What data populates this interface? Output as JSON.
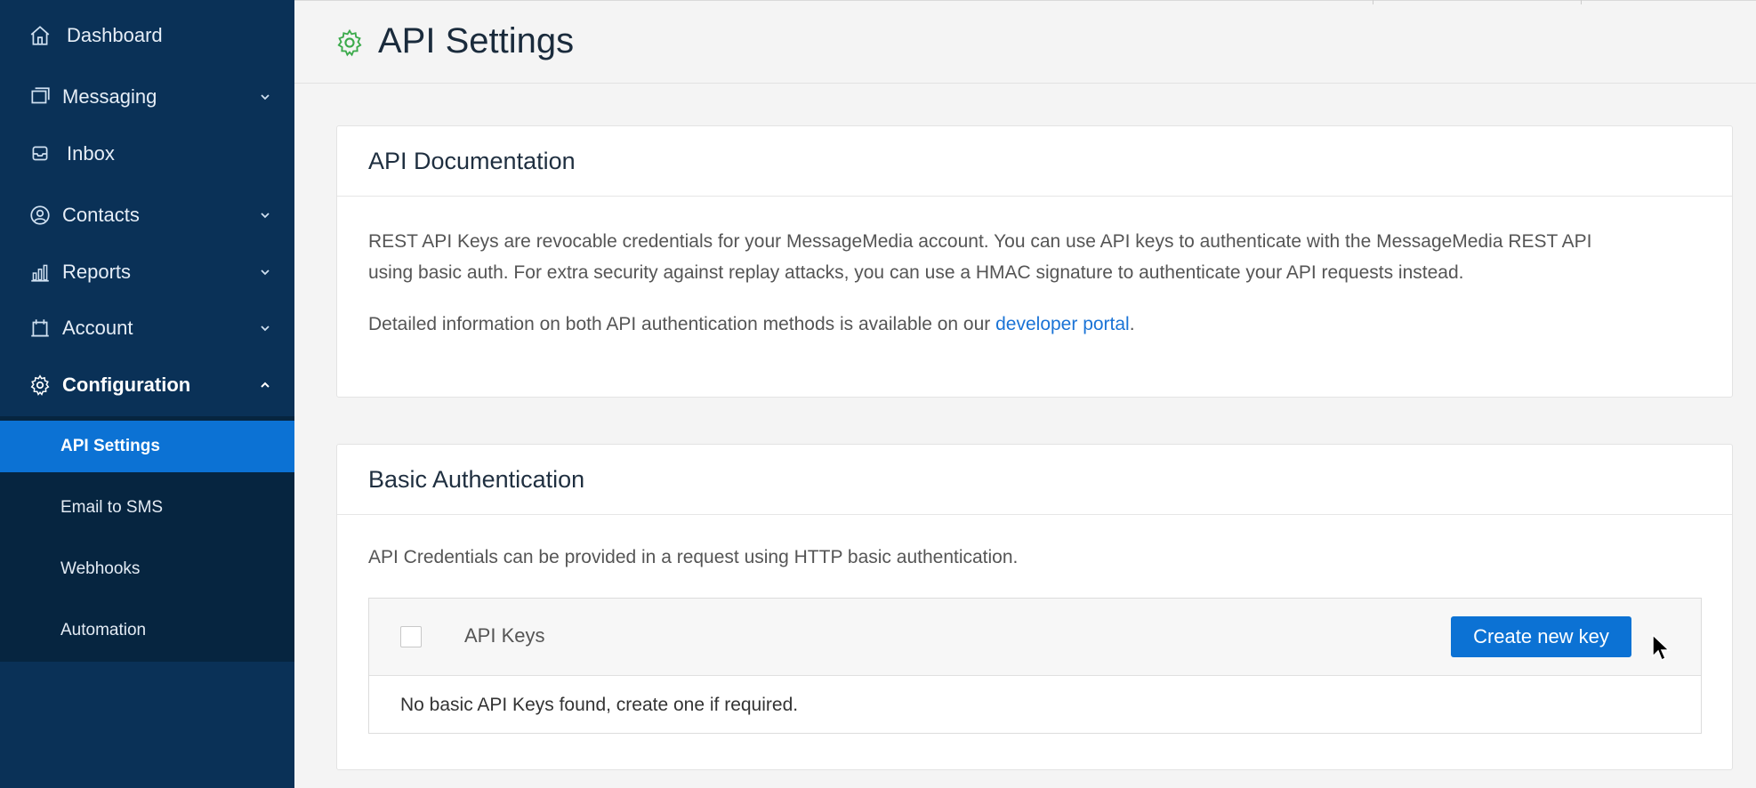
{
  "sidebar": {
    "items": [
      {
        "label": "Dashboard",
        "icon": "home-icon"
      },
      {
        "label": "Messaging",
        "icon": "message-icon"
      },
      {
        "label": "Inbox",
        "icon": "inbox-icon"
      },
      {
        "label": "Contacts",
        "icon": "contacts-icon"
      },
      {
        "label": "Reports",
        "icon": "reports-icon"
      },
      {
        "label": "Account",
        "icon": "account-icon"
      },
      {
        "label": "Configuration",
        "icon": "gear-icon"
      }
    ],
    "submenu": [
      {
        "label": "API Settings"
      },
      {
        "label": "Email to SMS"
      },
      {
        "label": "Webhooks"
      },
      {
        "label": "Automation"
      }
    ]
  },
  "header": {
    "title": "API Settings",
    "icon": "gear-icon"
  },
  "api_docs": {
    "title": "API Documentation",
    "para1": "REST API Keys are revocable credentials for your MessageMedia account. You can use API keys to authenticate with the MessageMedia REST API",
    "para1b": "using basic auth. For extra security against replay attacks, you can use a HMAC signature to authenticate your API requests instead.",
    "para2_prefix": "Detailed information on both API authentication methods is available on our ",
    "para2_link": "developer portal",
    "para2_suffix": "."
  },
  "basic_auth": {
    "title": "Basic Authentication",
    "description": "API Credentials can be provided in a request using HTTP basic authentication.",
    "table_header": "API Keys",
    "create_button": "Create new key",
    "empty_message": "No basic API Keys found, create one if required."
  },
  "colors": {
    "sidebar_bg": "#0a3157",
    "submenu_bg": "#062540",
    "accent": "#0c72d4",
    "icon_green": "#3aaa4a"
  }
}
